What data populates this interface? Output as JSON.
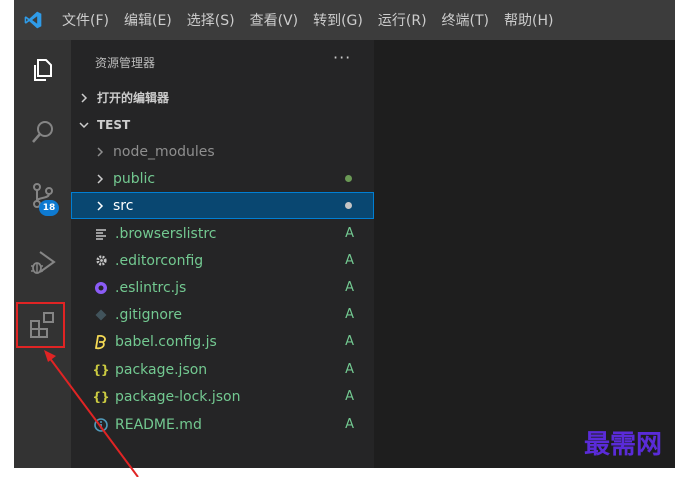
{
  "menubar": {
    "items": [
      "文件(F)",
      "编辑(E)",
      "选择(S)",
      "查看(V)",
      "转到(G)",
      "运行(R)",
      "终端(T)",
      "帮助(H)"
    ]
  },
  "activity_bar": {
    "source_control_badge": "18"
  },
  "explorer": {
    "title": "资源管理器",
    "more": "···",
    "open_editors_label": "打开的编辑器",
    "folder_label": "TEST",
    "items": [
      {
        "name": "node_modules",
        "kind": "folder",
        "status": "",
        "dot": ""
      },
      {
        "name": "public",
        "kind": "folder",
        "status": "",
        "dot": "#6a9955"
      },
      {
        "name": "src",
        "kind": "folder",
        "status": "",
        "dot": "#c5c5c5"
      },
      {
        "name": ".browserslistrc",
        "kind": "file",
        "status": "A",
        "dot": ""
      },
      {
        "name": ".editorconfig",
        "kind": "file",
        "status": "A",
        "dot": ""
      },
      {
        "name": ".eslintrc.js",
        "kind": "file",
        "status": "A",
        "dot": ""
      },
      {
        "name": ".gitignore",
        "kind": "file",
        "status": "A",
        "dot": ""
      },
      {
        "name": "babel.config.js",
        "kind": "file",
        "status": "A",
        "dot": ""
      },
      {
        "name": "package.json",
        "kind": "file",
        "status": "A",
        "dot": ""
      },
      {
        "name": "package-lock.json",
        "kind": "file",
        "status": "A",
        "dot": ""
      },
      {
        "name": "README.md",
        "kind": "file",
        "status": "A",
        "dot": ""
      }
    ]
  },
  "colors": {
    "added_green": "#73c991",
    "folder_grey": "#8f8f8f",
    "selection": "#094771",
    "highlight_red": "#e02424"
  },
  "watermark": "最需网"
}
